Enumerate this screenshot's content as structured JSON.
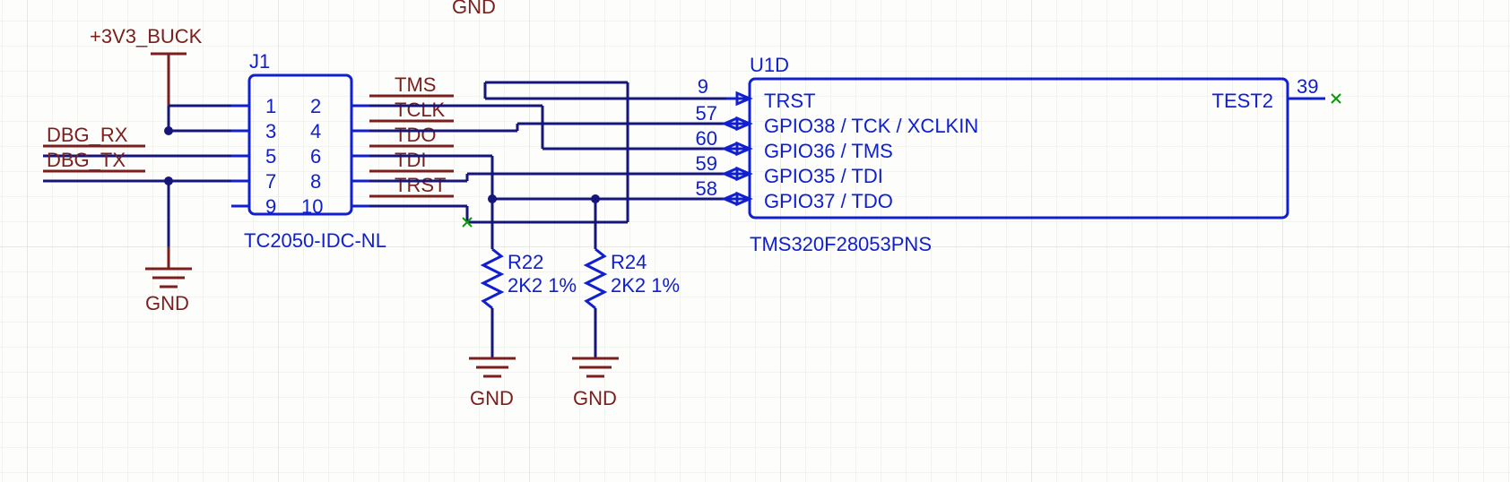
{
  "top_gnd": "GND",
  "power_label": "+3V3_BUCK",
  "connector": {
    "ref": "J1",
    "part": "TC2050-IDC-NL",
    "pins_left": [
      "1",
      "3",
      "5",
      "7",
      "9"
    ],
    "pins_right": [
      "2",
      "4",
      "6",
      "8",
      "10"
    ]
  },
  "debug": {
    "rx": "DBG_RX",
    "tx": "DBG_TX"
  },
  "gnd_j1": "GND",
  "right_nets": [
    "TMS",
    "TCLK",
    "TDO",
    "TDI",
    "TRST"
  ],
  "resistors": {
    "r22": {
      "ref": "R22",
      "value": "2K2 1%"
    },
    "r24": {
      "ref": "R24",
      "value": "2K2 1%"
    }
  },
  "gnd_r22": "GND",
  "gnd_r24": "GND",
  "ic": {
    "ref": "U1D",
    "part": "TMS320F28053PNS",
    "left_pins": [
      {
        "num": "9",
        "name": "TRST"
      },
      {
        "num": "57",
        "name": "GPIO38 / TCK / XCLKIN"
      },
      {
        "num": "60",
        "name": "GPIO36 / TMS"
      },
      {
        "num": "59",
        "name": "GPIO35 / TDI"
      },
      {
        "num": "58",
        "name": "GPIO37 / TDO"
      }
    ],
    "right_pin": {
      "num": "39",
      "name": "TEST2"
    }
  }
}
